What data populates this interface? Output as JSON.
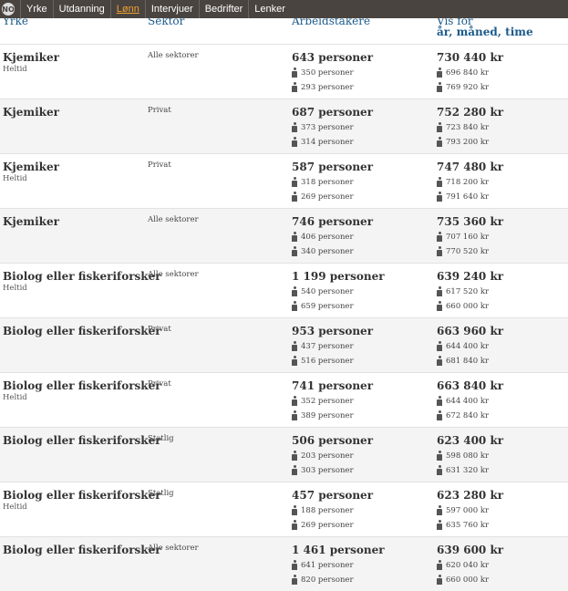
{
  "nav": {
    "logo_text": "NO",
    "items": [
      "Yrke",
      "Utdanning",
      "Lønn",
      "Intervjuer",
      "Bedrifter",
      "Lenker"
    ],
    "active": "Lønn"
  },
  "table": {
    "headers": {
      "yrke": "Yrke",
      "sektor": "Sektor",
      "arbeidstakere": "Arbeidstakere",
      "vis_for": "Vis for",
      "periods": "år, måned, time"
    },
    "rows": [
      {
        "title": "Kjemiker",
        "sub": "Heltid",
        "sector": "Alle sektorer",
        "total": "643 personer",
        "g1": "350 personer",
        "g2": "293 personer",
        "pay": "730 440 kr",
        "pay1": "696 840 kr",
        "pay2": "769 920 kr"
      },
      {
        "title": "Kjemiker",
        "sub": "",
        "sector": "Privat",
        "total": "687 personer",
        "g1": "373 personer",
        "g2": "314 personer",
        "pay": "752 280 kr",
        "pay1": "723 840 kr",
        "pay2": "793 200 kr"
      },
      {
        "title": "Kjemiker",
        "sub": "Heltid",
        "sector": "Privat",
        "total": "587 personer",
        "g1": "318 personer",
        "g2": "269 personer",
        "pay": "747 480 kr",
        "pay1": "718 200 kr",
        "pay2": "791 640 kr"
      },
      {
        "title": "Kjemiker",
        "sub": "",
        "sector": "Alle sektorer",
        "total": "746 personer",
        "g1": "406 personer",
        "g2": "340 personer",
        "pay": "735 360 kr",
        "pay1": "707 160 kr",
        "pay2": "770 520 kr"
      },
      {
        "title": "Biolog eller fiskeriforsker",
        "sub": "Heltid",
        "sector": "Alle sektorer",
        "total": "1 199 personer",
        "g1": "540 personer",
        "g2": "659 personer",
        "pay": "639 240 kr",
        "pay1": "617 520 kr",
        "pay2": "660 000 kr"
      },
      {
        "title": "Biolog eller fiskeriforsker",
        "sub": "",
        "sector": "Privat",
        "total": "953 personer",
        "g1": "437 personer",
        "g2": "516 personer",
        "pay": "663 960 kr",
        "pay1": "644 400 kr",
        "pay2": "681 840 kr"
      },
      {
        "title": "Biolog eller fiskeriforsker",
        "sub": "Heltid",
        "sector": "Privat",
        "total": "741 personer",
        "g1": "352 personer",
        "g2": "389 personer",
        "pay": "663 840 kr",
        "pay1": "644 400 kr",
        "pay2": "672 840 kr"
      },
      {
        "title": "Biolog eller fiskeriforsker",
        "sub": "",
        "sector": "Statlig",
        "total": "506 personer",
        "g1": "203 personer",
        "g2": "303 personer",
        "pay": "623 400 kr",
        "pay1": "598 080 kr",
        "pay2": "631 320 kr"
      },
      {
        "title": "Biolog eller fiskeriforsker",
        "sub": "Heltid",
        "sector": "Statlig",
        "total": "457 personer",
        "g1": "188 personer",
        "g2": "269 personer",
        "pay": "623 280 kr",
        "pay1": "597 000 kr",
        "pay2": "635 760 kr"
      },
      {
        "title": "Biolog eller fiskeriforsker",
        "sub": "",
        "sector": "Alle sektorer",
        "total": "1 461 personer",
        "g1": "641 personer",
        "g2": "820 personer",
        "pay": "639 600 kr",
        "pay1": "620 040 kr",
        "pay2": "660 000 kr"
      }
    ]
  }
}
